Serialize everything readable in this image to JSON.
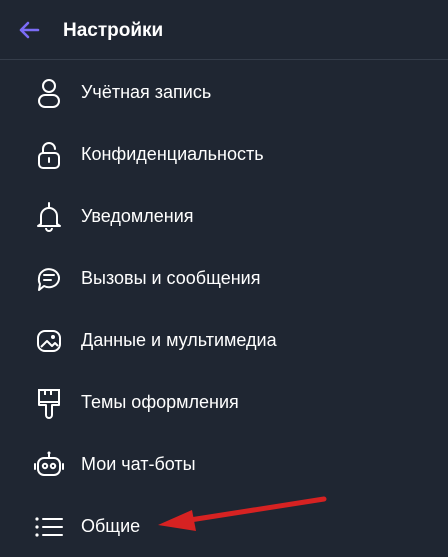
{
  "header": {
    "title": "Настройки",
    "back_icon": "arrow-left-icon",
    "accent_color": "#7b6cf6"
  },
  "menu": {
    "items": [
      {
        "label": "Учётная запись",
        "icon": "person-icon"
      },
      {
        "label": "Конфиденциальность",
        "icon": "lock-icon"
      },
      {
        "label": "Уведомления",
        "icon": "bell-icon"
      },
      {
        "label": "Вызовы и сообщения",
        "icon": "chat-icon"
      },
      {
        "label": "Данные и мультимедиа",
        "icon": "media-icon"
      },
      {
        "label": "Темы оформления",
        "icon": "brush-icon"
      },
      {
        "label": "Мои чат-боты",
        "icon": "bot-icon"
      },
      {
        "label": "Общие",
        "icon": "list-icon"
      }
    ]
  },
  "annotation": {
    "color": "#d62222",
    "icon": "red-arrow-pointer"
  }
}
